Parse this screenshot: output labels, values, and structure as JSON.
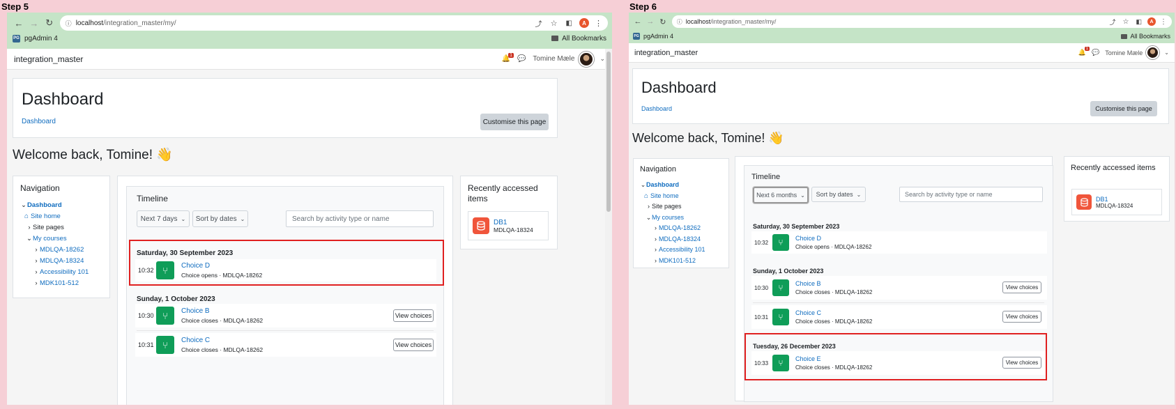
{
  "steps": [
    {
      "label": "Step 5",
      "browser": {
        "url_host": "localhost",
        "url_path": "/integration_master/my/",
        "bookmark": "pgAdmin 4",
        "all_bookmarks": "All Bookmarks",
        "profile_initial": "A"
      },
      "site": {
        "name": "integration_master",
        "user": "Tomine Mæle",
        "notification_count": "1"
      },
      "header": {
        "title": "Dashboard",
        "breadcrumb": "Dashboard",
        "customise": "Customise this page"
      },
      "welcome": "Welcome back, Tomine! 👋",
      "navigation": {
        "title": "Navigation",
        "items": [
          "Dashboard",
          "Site home",
          "Site pages",
          "My courses",
          "MDLQA-18262",
          "MDLQA-18324",
          "Accessibility 101",
          "MDK101-512"
        ]
      },
      "timeline": {
        "title": "Timeline",
        "range_select": "Next 7 days",
        "sort_select": "Sort by dates",
        "search_placeholder": "Search by activity type or name",
        "groups": [
          {
            "date": "Saturday, 30 September 2023",
            "events": [
              {
                "time": "10:32",
                "title": "Choice D",
                "sub": "Choice opens · MDLQA-18262",
                "action": ""
              }
            ]
          },
          {
            "date": "Sunday, 1 October 2023",
            "events": [
              {
                "time": "10:30",
                "title": "Choice B",
                "sub": "Choice closes · MDLQA-18262",
                "action": "View choices"
              },
              {
                "time": "10:31",
                "title": "Choice C",
                "sub": "Choice closes · MDLQA-18262",
                "action": "View choices"
              }
            ]
          }
        ]
      },
      "recent": {
        "title": "Recently accessed items",
        "item_name": "DB1",
        "item_code": "MDLQA-18324"
      }
    },
    {
      "label": "Step 6",
      "browser": {
        "url_host": "localhost",
        "url_path": "/integration_master/my/",
        "bookmark": "pgAdmin 4",
        "all_bookmarks": "All Bookmarks",
        "profile_initial": "A"
      },
      "site": {
        "name": "integration_master",
        "user": "Tomine Mæle",
        "notification_count": "1"
      },
      "header": {
        "title": "Dashboard",
        "breadcrumb": "Dashboard",
        "customise": "Customise this page"
      },
      "welcome": "Welcome back, Tomine! 👋",
      "navigation": {
        "title": "Navigation",
        "items": [
          "Dashboard",
          "Site home",
          "Site pages",
          "My courses",
          "MDLQA-18262",
          "MDLQA-18324",
          "Accessibility 101",
          "MDK101-512"
        ]
      },
      "timeline": {
        "title": "Timeline",
        "range_select": "Next 6 months",
        "sort_select": "Sort by dates",
        "search_placeholder": "Search by activity type or name",
        "groups": [
          {
            "date": "Saturday, 30 September 2023",
            "events": [
              {
                "time": "10:32",
                "title": "Choice D",
                "sub": "Choice opens · MDLQA-18262",
                "action": ""
              }
            ]
          },
          {
            "date": "Sunday, 1 October 2023",
            "events": [
              {
                "time": "10:30",
                "title": "Choice B",
                "sub": "Choice closes · MDLQA-18262",
                "action": "View choices"
              },
              {
                "time": "10:31",
                "title": "Choice C",
                "sub": "Choice closes · MDLQA-18262",
                "action": "View choices"
              }
            ]
          },
          {
            "date": "Tuesday, 26 December 2023",
            "events": [
              {
                "time": "10:33",
                "title": "Choice E",
                "sub": "Choice closes · MDLQA-18262",
                "action": "View choices"
              }
            ]
          }
        ]
      },
      "recent": {
        "title": "Recently accessed items",
        "item_name": "DB1",
        "item_code": "MDLQA-18324"
      }
    }
  ],
  "colors": {
    "highlight": "#e02020",
    "link": "#0f6cbf",
    "chrome": "#c5e4c7",
    "backdrop": "#f6cfd6",
    "activity_icon": "#0f9d58",
    "database_icon": "#f0553b"
  }
}
